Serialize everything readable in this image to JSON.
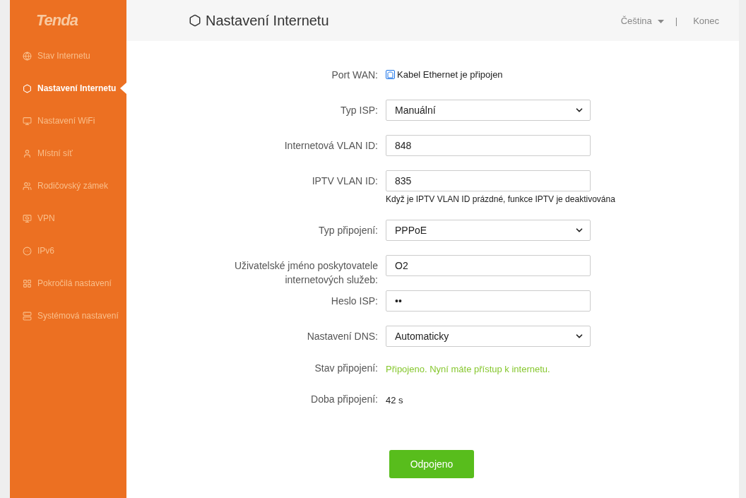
{
  "logo": "Tenda",
  "sidebar": {
    "items": [
      {
        "label": "Stav Internetu",
        "selected": false
      },
      {
        "label": "Nastavení Internetu",
        "selected": true
      },
      {
        "label": "Nastavení WiFi",
        "selected": false
      },
      {
        "label": "Místní síť",
        "selected": false
      },
      {
        "label": "Rodičovský zámek",
        "selected": false
      },
      {
        "label": "VPN",
        "selected": false
      },
      {
        "label": "IPv6",
        "selected": false
      },
      {
        "label": "Pokročilá nastavení",
        "selected": false
      },
      {
        "label": "Systémová nastavení",
        "selected": false
      }
    ]
  },
  "header": {
    "title": "Nastavení Internetu",
    "language": "Čeština",
    "separator": "|",
    "logout": "Konec"
  },
  "form": {
    "rows": [
      {
        "kind": "port",
        "label": "Port WAN:",
        "value": "Kabel Ethernet je připojen"
      },
      {
        "kind": "select",
        "label": "Typ ISP:",
        "value": "Manuální"
      },
      {
        "kind": "input",
        "label": "Internetová VLAN ID:",
        "value": "848"
      },
      {
        "kind": "input",
        "label": "IPTV VLAN ID:",
        "value": "835",
        "hint": "Když je IPTV VLAN ID prázdné, funkce IPTV je deaktivována"
      },
      {
        "kind": "select",
        "label": "Typ připojení:",
        "value": "PPPoE"
      },
      {
        "kind": "input",
        "label": "Uživatelské jméno poskytovatele internetových služeb:",
        "value": "O2"
      },
      {
        "kind": "password",
        "label": "Heslo ISP:",
        "value": "••"
      },
      {
        "kind": "select",
        "label": "Nastavení DNS:",
        "value": "Automaticky"
      },
      {
        "kind": "status",
        "label": "Stav připojení:",
        "value": "Připojeno. Nyní máte přístup k internetu."
      },
      {
        "kind": "text",
        "label": "Doba připojení:",
        "value": "42 s"
      }
    ],
    "button": "Odpojeno"
  }
}
